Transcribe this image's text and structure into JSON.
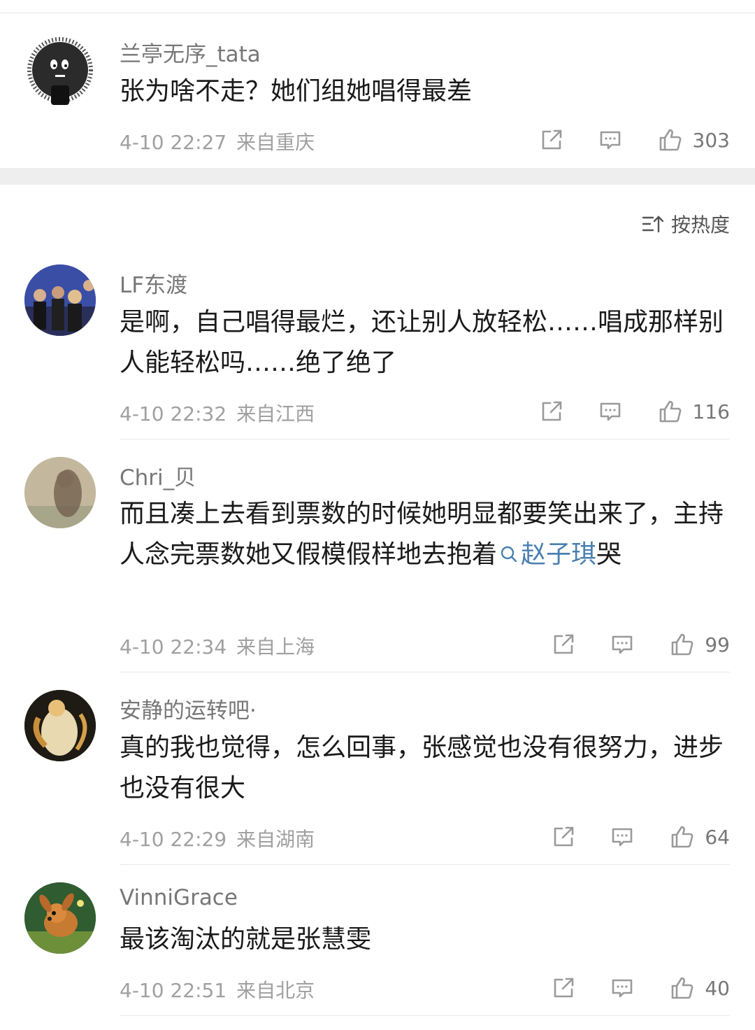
{
  "top_comment": {
    "username": "兰亭无序_tata",
    "text": "张为啥不走？她们组她唱得最差",
    "time": "4-10 22:27",
    "location": "来自重庆",
    "likes": "303"
  },
  "sort_label": "按热度",
  "replies": [
    {
      "username": "LF东渡",
      "text": "是啊，自己唱得最烂，还让别人放轻松……唱成那样别人能轻松吗……绝了绝了",
      "time": "4-10 22:32",
      "location": "来自江西",
      "likes": "116"
    },
    {
      "username": "Chri_贝",
      "text_before": "而且凑上去看到票数的时候她明显都要笑出来了，主持人念完票数她又假模假样地去抱着",
      "mention": "赵子琪",
      "text_after": "哭",
      "time": "4-10 22:34",
      "location": "来自上海",
      "likes": "99"
    },
    {
      "username": "安静的运转吧·",
      "text": "真的我也觉得，怎么回事，张感觉也没有很努力，进步也没有很大",
      "time": "4-10 22:29",
      "location": "来自湖南",
      "likes": "64"
    },
    {
      "username": "VinniGrace",
      "text": "最该淘汰的就是张慧雯",
      "time": "4-10 22:51",
      "location": "来自北京",
      "likes": "40"
    }
  ],
  "icons": {
    "share": "share-icon",
    "reply": "comment-icon",
    "like": "thumbs-up-icon",
    "sort": "sort-icon",
    "search": "search-icon"
  },
  "colors": {
    "mention": "#4a7fb0",
    "meta": "#a0a0a0",
    "username": "#777777"
  }
}
